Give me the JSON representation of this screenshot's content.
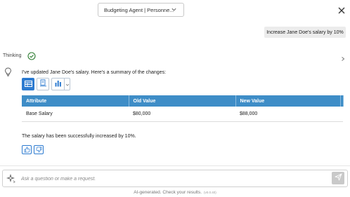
{
  "header": {
    "agent_select_value": "Budgeting Agent | Personne...",
    "close_icon": "close-icon"
  },
  "conversation": {
    "user_message": "Increase Jane Doe's salary by 10%",
    "thinking_label": "Thinking",
    "summary": "I've updated Jane Doe's salary. Here's a summary of the changes:",
    "view_icons": [
      "table-icon",
      "document-icon",
      "bar-chart-icon",
      "chevron-down-icon"
    ],
    "table": {
      "columns": [
        "Attribute",
        "Old Value",
        "New Value"
      ],
      "rows": [
        [
          "Base Salary",
          "$80,000",
          "$88,000"
        ]
      ]
    },
    "result_message": "The salary has been successfully increased by 10%.",
    "feedback_icons": [
      "thumbs-up-icon",
      "thumbs-down-icon"
    ]
  },
  "input": {
    "placeholder": "Ask a question or make a request."
  },
  "footer": {
    "disclaimer": "AI-generated. Check your results.",
    "version": "(v0.0.40)"
  },
  "colors": {
    "accent": "#2d7bd0",
    "table_header": "#3e8dc7",
    "thinking_check": "#2e7d32"
  }
}
